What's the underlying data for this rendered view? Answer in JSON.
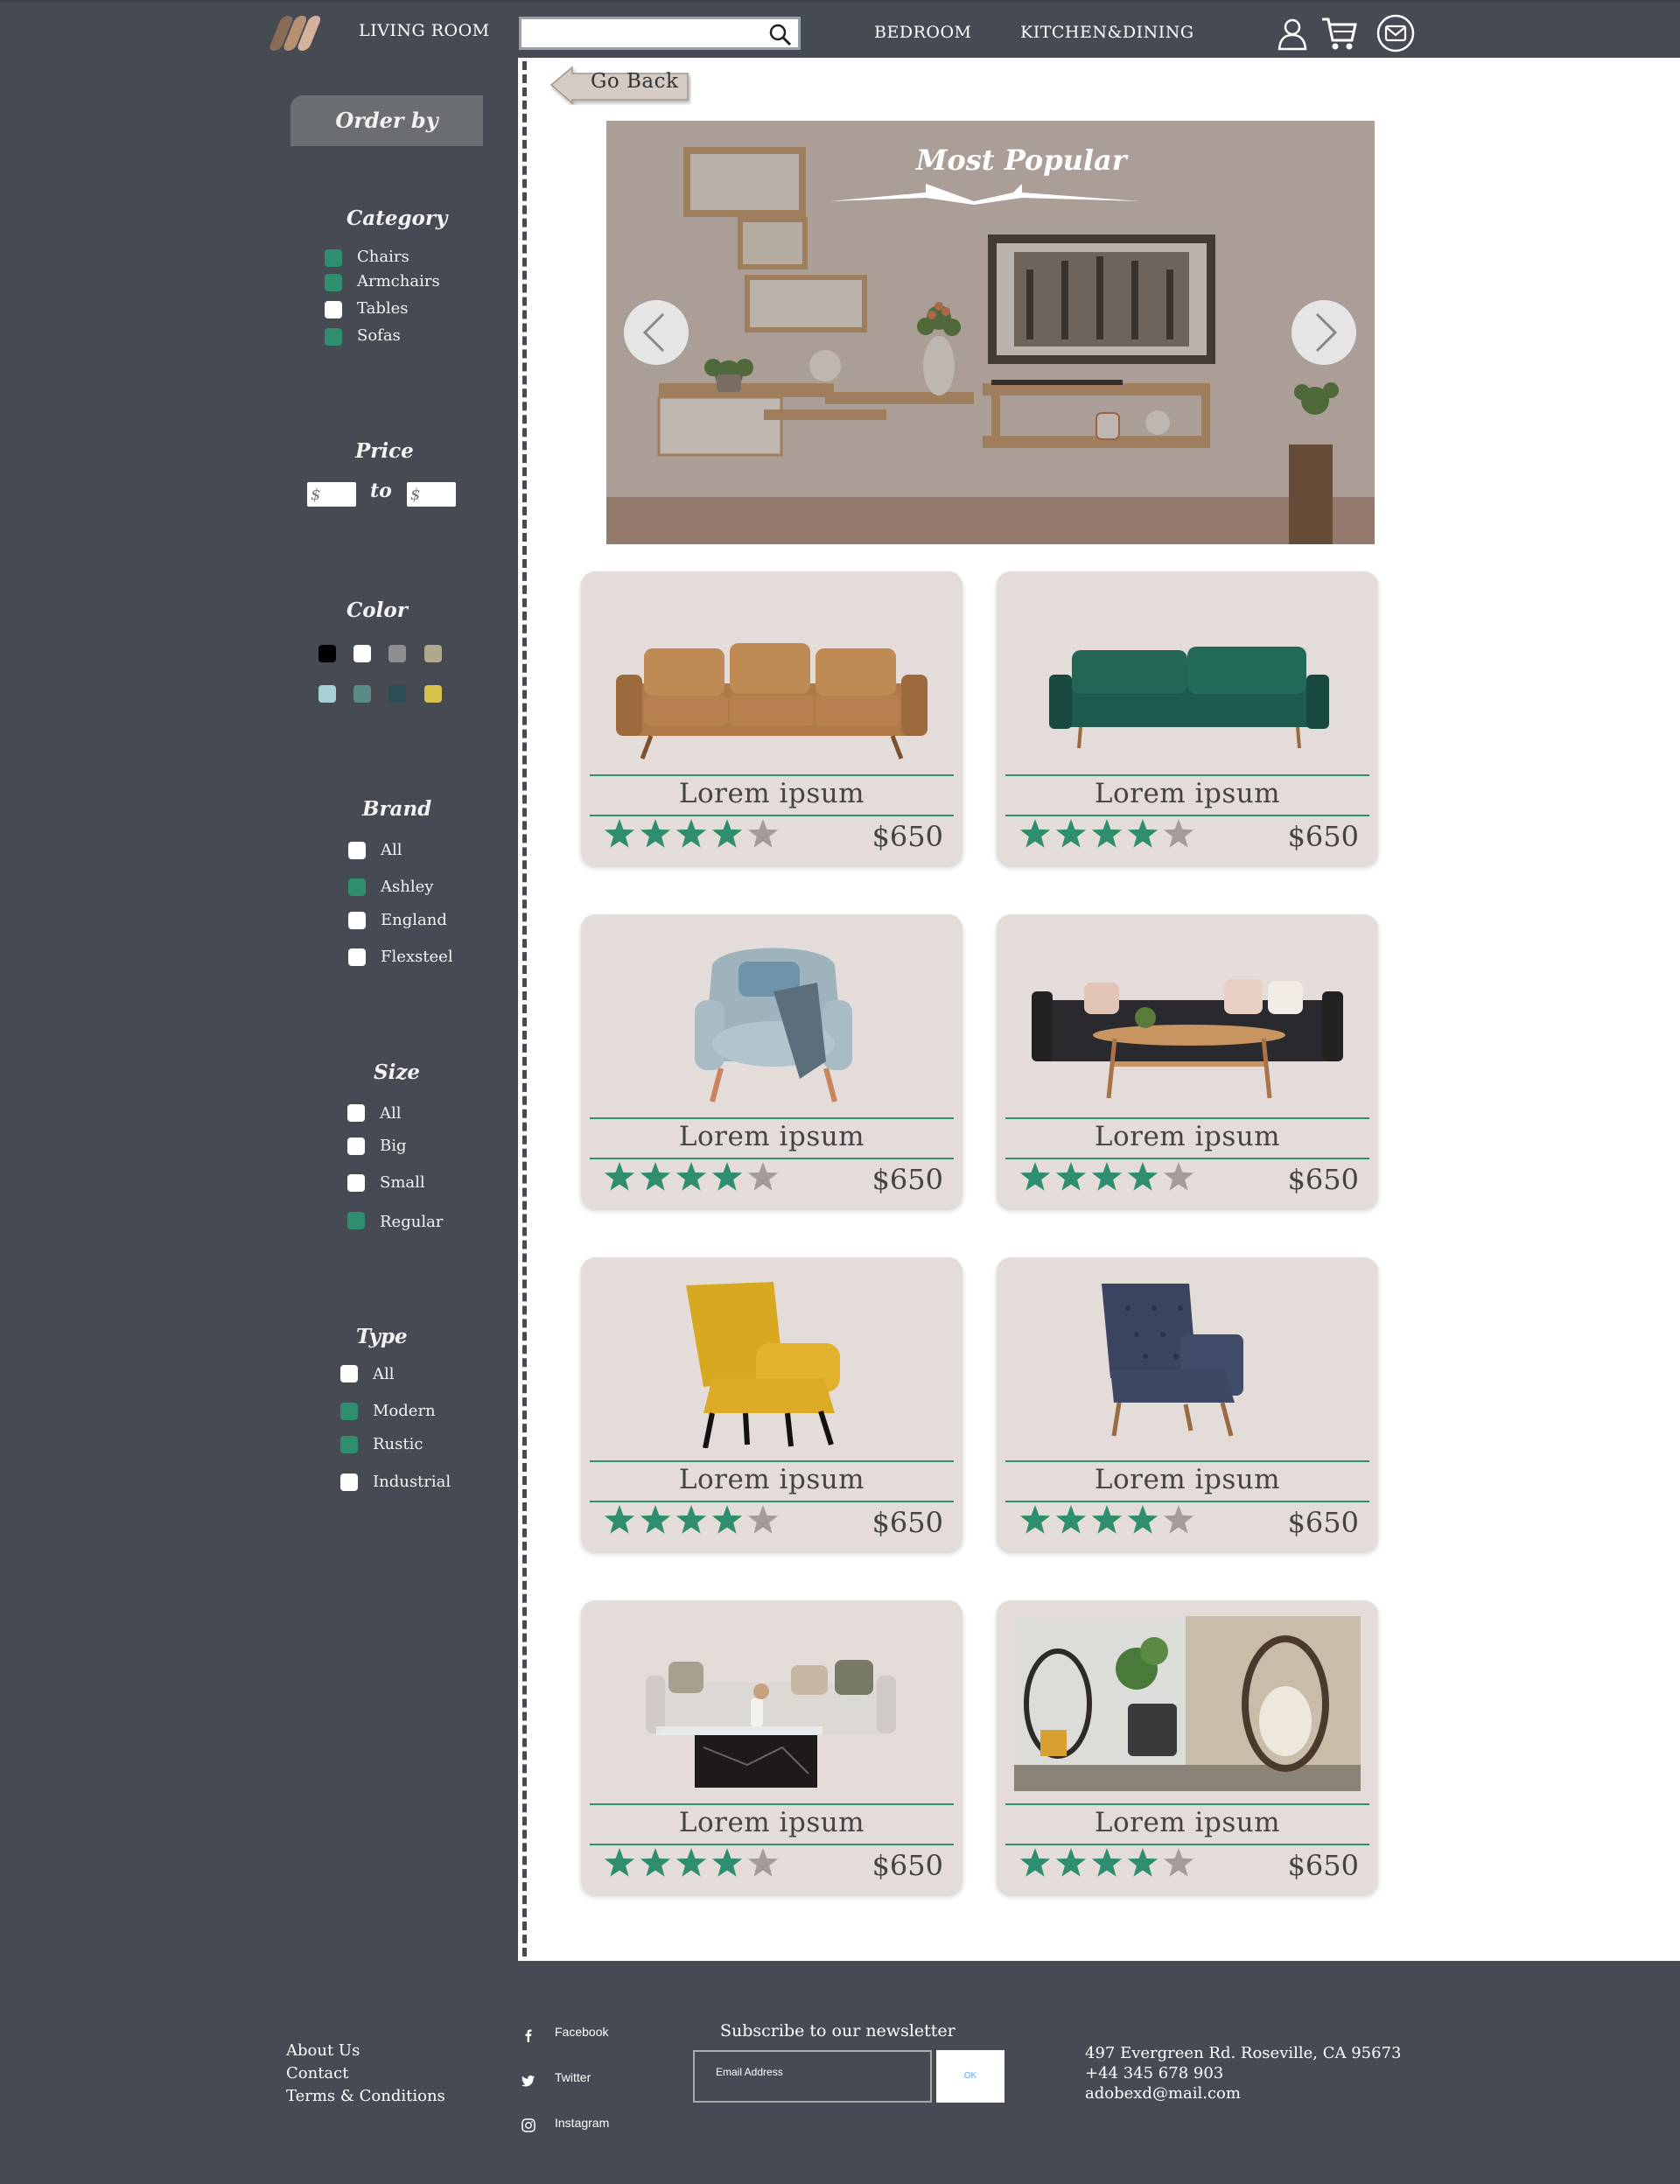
{
  "header": {
    "nav_living_room": "LIVING ROOM",
    "nav_bedroom": "BEDROOM",
    "nav_kitchen": "KITCHEN&DINING",
    "search_value": ""
  },
  "sidebar": {
    "order_by": "Order by",
    "category": {
      "title": "Category",
      "items": [
        {
          "label": "Chairs",
          "checked": true
        },
        {
          "label": "Armchairs",
          "checked": true
        },
        {
          "label": "Tables",
          "checked": false
        },
        {
          "label": "Sofas",
          "checked": true
        }
      ]
    },
    "price": {
      "title": "Price",
      "from_placeholder": "$",
      "to_label": "to",
      "to_placeholder": "$"
    },
    "color": {
      "title": "Color",
      "swatches": [
        "#000000",
        "#ffffff",
        "#8e8e8e",
        "#b0a88c",
        "#a8d0d4",
        "#5c8a88",
        "#2e4e56",
        "#d8c34a"
      ]
    },
    "brand": {
      "title": "Brand",
      "items": [
        {
          "label": "All",
          "checked": false
        },
        {
          "label": "Ashley",
          "checked": true
        },
        {
          "label": "England",
          "checked": false
        },
        {
          "label": "Flexsteel",
          "checked": false
        }
      ]
    },
    "size": {
      "title": "Size",
      "items": [
        {
          "label": "All",
          "checked": false
        },
        {
          "label": "Big",
          "checked": false
        },
        {
          "label": "Small",
          "checked": false
        },
        {
          "label": "Regular",
          "checked": true
        }
      ]
    },
    "type": {
      "title": "Type",
      "items": [
        {
          "label": "All",
          "checked": false
        },
        {
          "label": "Modern",
          "checked": true
        },
        {
          "label": "Rustic",
          "checked": true
        },
        {
          "label": "Industrial",
          "checked": false
        }
      ]
    }
  },
  "main": {
    "go_back": "Go Back",
    "hero_title": "Most Popular",
    "products": [
      {
        "title": "Lorem ipsum",
        "price": "$650",
        "rating": 4,
        "image": "leather-sofa"
      },
      {
        "title": "Lorem ipsum",
        "price": "$650",
        "rating": 4,
        "image": "green-velvet-sofa"
      },
      {
        "title": "Lorem ipsum",
        "price": "$650",
        "rating": 4,
        "image": "blue-armchair"
      },
      {
        "title": "Lorem ipsum",
        "price": "$650",
        "rating": 4,
        "image": "black-sofa-table"
      },
      {
        "title": "Lorem ipsum",
        "price": "$650",
        "rating": 4,
        "image": "yellow-armchair"
      },
      {
        "title": "Lorem ipsum",
        "price": "$650",
        "rating": 4,
        "image": "navy-tufted-armchair"
      },
      {
        "title": "Lorem ipsum",
        "price": "$650",
        "rating": 4,
        "image": "white-sofa-marble-table"
      },
      {
        "title": "Lorem ipsum",
        "price": "$650",
        "rating": 4,
        "image": "egg-chairs-patio"
      }
    ]
  },
  "footer": {
    "links": [
      "About Us",
      "Contact",
      "Terms & Conditions"
    ],
    "social": [
      "Facebook",
      "Twitter",
      "Instagram"
    ],
    "newsletter_title": "Subscribe to our newsletter",
    "email_placeholder": "Email Address",
    "ok_label": "OK",
    "address": "497 Evergreen Rd. Roseville, CA 95673",
    "phone": "+44 345 678 903",
    "email": "adobexd@mail.com"
  },
  "colors": {
    "accent": "#2e8e6e",
    "background": "#464a52",
    "card": "#e4dcd8",
    "star_off": "#a69a9a"
  }
}
